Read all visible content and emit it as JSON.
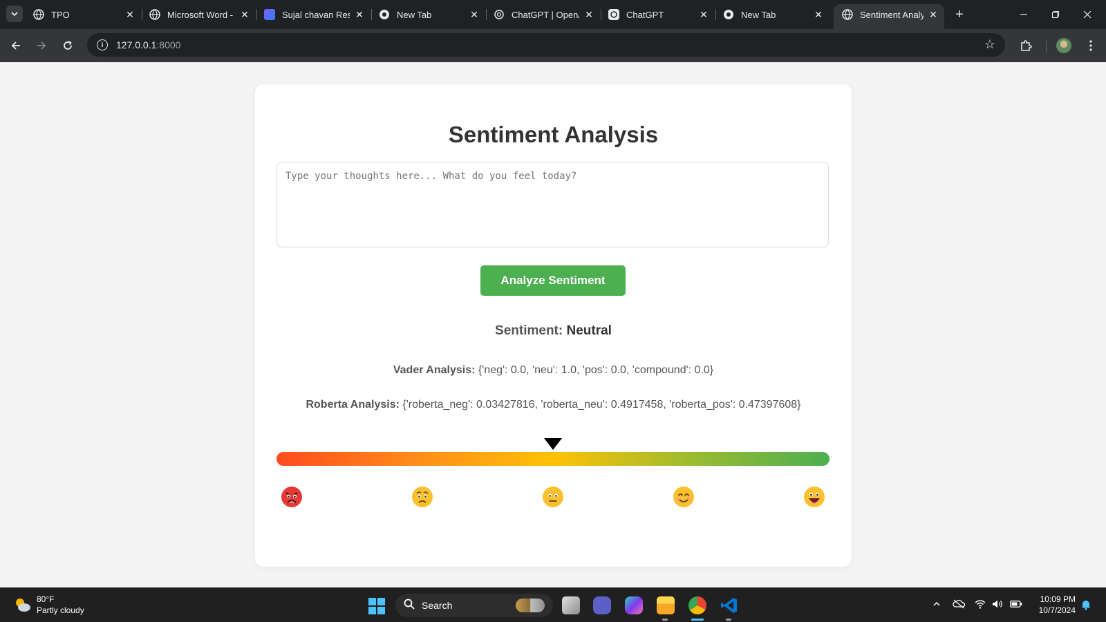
{
  "browser": {
    "tabs": [
      {
        "title": "TPO",
        "active": false
      },
      {
        "title": "Microsoft Word -",
        "active": false
      },
      {
        "title": "Sujal chavan Res",
        "active": false
      },
      {
        "title": "New Tab",
        "active": false
      },
      {
        "title": "ChatGPT | OpenA",
        "active": false
      },
      {
        "title": "ChatGPT",
        "active": false
      },
      {
        "title": "New Tab",
        "active": false
      },
      {
        "title": "Sentiment Analy",
        "active": true
      }
    ],
    "url_host": "127.0.0.1",
    "url_port": ":8000"
  },
  "app": {
    "title": "Sentiment Analysis",
    "input_placeholder": "Type your thoughts here... What do you feel today?",
    "input_value": "",
    "analyze_label": "Analyze Sentiment",
    "sentiment_label": "Sentiment:",
    "sentiment_value": "Neutral",
    "vader_label": "Vader Analysis:",
    "vader_value": "{'neg': 0.0, 'neu': 1.0, 'pos': 0.0, 'compound': 0.0}",
    "roberta_label": "Roberta Analysis:",
    "roberta_value": "{'roberta_neg': 0.03427816, 'roberta_neu': 0.4917458, 'roberta_pos': 0.47397608}",
    "gauge_position": 0.5,
    "gauge_colors": [
      "#ff4b1f",
      "#ff8c1a",
      "#ffc107",
      "#9bbb30",
      "#4caf50"
    ],
    "emojis": [
      "angry-face-icon",
      "sad-face-icon",
      "neutral-face-icon",
      "smiling-face-icon",
      "grinning-face-icon"
    ]
  },
  "taskbar": {
    "weather_temp": "80°F",
    "weather_desc": "Partly cloudy",
    "search_label": "Search",
    "time": "10:09 PM",
    "date": "10/7/2024"
  }
}
